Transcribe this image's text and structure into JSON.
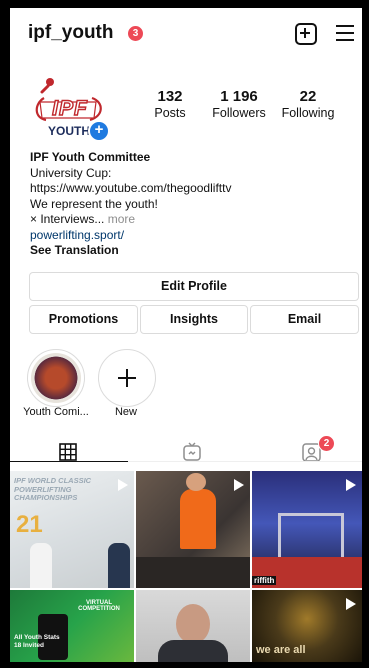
{
  "header": {
    "username": "ipf_youth",
    "notification_count": "3"
  },
  "profile": {
    "logo_text_main": "IPF",
    "logo_text_sub": "YOUTH",
    "stats": [
      {
        "value": "132",
        "label": "Posts"
      },
      {
        "value": "1 196",
        "label": "Followers"
      },
      {
        "value": "22",
        "label": "Following"
      }
    ]
  },
  "bio": {
    "name": "IPF Youth Committee",
    "line1": "University Cup:",
    "line2": "https://www.youtube.com/thegoodlifttv",
    "line3": "We represent the youth!",
    "line4": "× Interviews...",
    "more": "more",
    "link": "powerlifting.sport/",
    "translate": "See Translation"
  },
  "buttons": {
    "edit_profile": "Edit Profile",
    "promotions": "Promotions",
    "insights": "Insights",
    "email": "Email"
  },
  "highlights": [
    {
      "label": "Youth Comi..."
    },
    {
      "label": "New"
    }
  ],
  "tabs": {
    "tagged_count": "2"
  },
  "grid": {
    "post1_title": "IPF WORLD CLASSIC POWERLIFTING CHAMPIONSHIPS",
    "post1_number": "21",
    "post3_caption": "riffith",
    "post4_text": "All Youth Stats 18 Invited",
    "post4_caption": "VIRTUAL COMPETITION",
    "post6_text": "we are all"
  },
  "colors": {
    "notification": "#ed4956",
    "link": "#00376b",
    "accent_blue": "#1f7ae0",
    "logo_red": "#c0282d"
  }
}
